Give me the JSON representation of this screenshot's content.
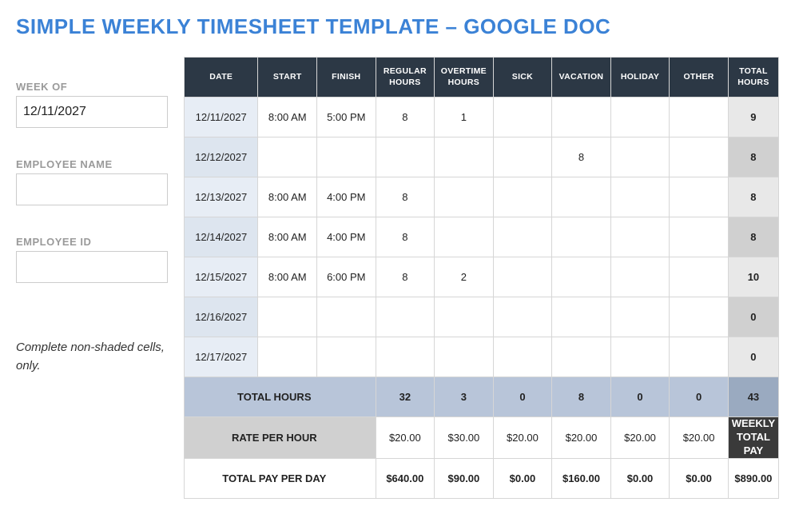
{
  "title": "SIMPLE WEEKLY TIMESHEET TEMPLATE – GOOGLE DOC",
  "sidebar": {
    "week_of_label": "WEEK OF",
    "week_of_value": "12/11/2027",
    "employee_name_label": "EMPLOYEE NAME",
    "employee_name_value": "",
    "employee_id_label": "EMPLOYEE ID",
    "employee_id_value": "",
    "note": "Complete non-shaded cells, only."
  },
  "headers": {
    "date": "DATE",
    "start": "START",
    "finish": "FINISH",
    "regular": "REGULAR HOURS",
    "overtime": "OVERTIME HOURS",
    "sick": "SICK",
    "vacation": "VACATION",
    "holiday": "HOLIDAY",
    "other": "OTHER",
    "total": "TOTAL HOURS"
  },
  "rows": [
    {
      "date": "12/11/2027",
      "start": "8:00 AM",
      "finish": "5:00 PM",
      "regular": "8",
      "overtime": "1",
      "sick": "",
      "vacation": "",
      "holiday": "",
      "other": "",
      "total": "9"
    },
    {
      "date": "12/12/2027",
      "start": "",
      "finish": "",
      "regular": "",
      "overtime": "",
      "sick": "",
      "vacation": "8",
      "holiday": "",
      "other": "",
      "total": "8"
    },
    {
      "date": "12/13/2027",
      "start": "8:00 AM",
      "finish": "4:00 PM",
      "regular": "8",
      "overtime": "",
      "sick": "",
      "vacation": "",
      "holiday": "",
      "other": "",
      "total": "8"
    },
    {
      "date": "12/14/2027",
      "start": "8:00 AM",
      "finish": "4:00 PM",
      "regular": "8",
      "overtime": "",
      "sick": "",
      "vacation": "",
      "holiday": "",
      "other": "",
      "total": "8"
    },
    {
      "date": "12/15/2027",
      "start": "8:00 AM",
      "finish": "6:00 PM",
      "regular": "8",
      "overtime": "2",
      "sick": "",
      "vacation": "",
      "holiday": "",
      "other": "",
      "total": "10"
    },
    {
      "date": "12/16/2027",
      "start": "",
      "finish": "",
      "regular": "",
      "overtime": "",
      "sick": "",
      "vacation": "",
      "holiday": "",
      "other": "",
      "total": "0"
    },
    {
      "date": "12/17/2027",
      "start": "",
      "finish": "",
      "regular": "",
      "overtime": "",
      "sick": "",
      "vacation": "",
      "holiday": "",
      "other": "",
      "total": "0"
    }
  ],
  "totals": {
    "label": "TOTAL HOURS",
    "regular": "32",
    "overtime": "3",
    "sick": "0",
    "vacation": "8",
    "holiday": "0",
    "other": "0",
    "total": "43"
  },
  "rate": {
    "label": "RATE PER HOUR",
    "regular": "$20.00",
    "overtime": "$30.00",
    "sick": "$20.00",
    "vacation": "$20.00",
    "holiday": "$20.00",
    "other": "$20.00",
    "weekly_label": "WEEKLY TOTAL PAY"
  },
  "pay": {
    "label": "TOTAL PAY PER DAY",
    "regular": "$640.00",
    "overtime": "$90.00",
    "sick": "$0.00",
    "vacation": "$160.00",
    "holiday": "$0.00",
    "other": "$0.00",
    "total": "$890.00"
  }
}
